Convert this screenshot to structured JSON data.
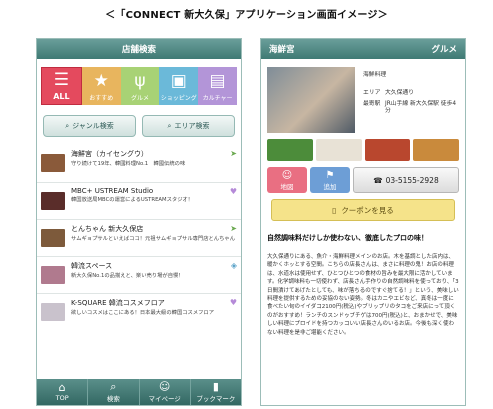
{
  "page_title": "＜「CONNECT 新大久保」アプリケーション画面イメージ＞",
  "colors": {
    "header": "#4f8a84",
    "all": "#e44a5e",
    "recommend": "#e8b55e",
    "gourmet": "#a8d275",
    "shopping": "#6bb9d9",
    "culture": "#b395d8",
    "coupon": "#f5e38a"
  },
  "left": {
    "header": "店舗検索",
    "categories": [
      {
        "label": "ALL",
        "icon": "list-icon"
      },
      {
        "label": "おすすめ",
        "icon": "star-icon"
      },
      {
        "label": "グルメ",
        "icon": "fork-knife-icon"
      },
      {
        "label": "ショッピング",
        "icon": "shopping-bag-icon"
      },
      {
        "label": "カルチャー",
        "icon": "book-icon"
      }
    ],
    "search_genre": "ジャンル検索",
    "search_area": "エリア検索",
    "stores": [
      {
        "title": "海鮮宮（カイセングウ）",
        "desc": "守り続けて19年、韓國料理No.1　韓國伝統の味",
        "icon": "fish-icon",
        "thumb": "#8a5a3a"
      },
      {
        "title": "MBC+ USTREAM Studio",
        "desc": "韓国放送局MBCの運営によるUSTREAMスタジオ！",
        "icon": "heart-icon",
        "thumb": "#5a2d2a"
      },
      {
        "title": "とんちゃん 新大久保店",
        "desc": "サムギョプサルといえばココ！元祖サムギョプサル専門店とんちゃん",
        "icon": "fish-icon",
        "thumb": "#7d5a3b"
      },
      {
        "title": "韓流スペース",
        "desc": "新大久保No.1の品揃えと、楽い売り場が自慢！",
        "icon": "shopping-bag-icon",
        "thumb": "#b07a8e"
      },
      {
        "title": "K-SQUARE 韓流コスメフロア",
        "desc": "欲しいコスメはここにある！日本最大級の韓国コスメフロア",
        "icon": "heart-icon",
        "thumb": "#c9c2cc"
      }
    ],
    "tabs": [
      {
        "label": "TOP",
        "icon": "home-icon"
      },
      {
        "label": "検索",
        "icon": "search-icon"
      },
      {
        "label": "マイページ",
        "icon": "user-icon"
      },
      {
        "label": "ブックマーク",
        "icon": "bookmark-icon"
      }
    ]
  },
  "right": {
    "header_title": "海鮮宮",
    "header_category": "グルメ",
    "genre": "海鮮料理",
    "area_key": "エリア",
    "area_value": "大久保通り",
    "station_key": "最寄駅",
    "station_value": "JR山手線 新大久保駅 徒歩4分",
    "gallery_colors": [
      "#4c8c3a",
      "#e8e2d6",
      "#b9472e",
      "#c98a3c"
    ],
    "map_label": "地図",
    "add_label": "追加",
    "phone": "03-5155-2928",
    "coupon_label": "クーポンを見る",
    "catch": "自然調味料だけしか使わない、徹底したプロの味！",
    "description": "大久保通りにある、魚介・海鮮料理メインのお店。木を基調とした店内は、暖かくホッとする空間。こちらの店長さんは、まさに料理の鬼！お店の料理は、水道水は使用せず、ひとつひとつの食材の旨みを最大限に活かしています。化学調味料も一切使わず、店長さん手作りの自然調味料を使っており、「3日間漬けてあげたとしても、味が落ちるのですぐ捨てる！」という、美味しい料理を提供するための妥協のない姿勢。冬はカニやエビなど、真冬は一度に食べたい旬のイイダコ2100円(税込)やブリップリのタコをご来店にって頂くのがおすすめ！ランチのスンドゥブチゲは700円(税込)と、おまかせで、美味しい料理にプロイドを持つカッコいい店長さんのいるお店。今後も深く使わない料理を是非ご堪能ください。"
  }
}
